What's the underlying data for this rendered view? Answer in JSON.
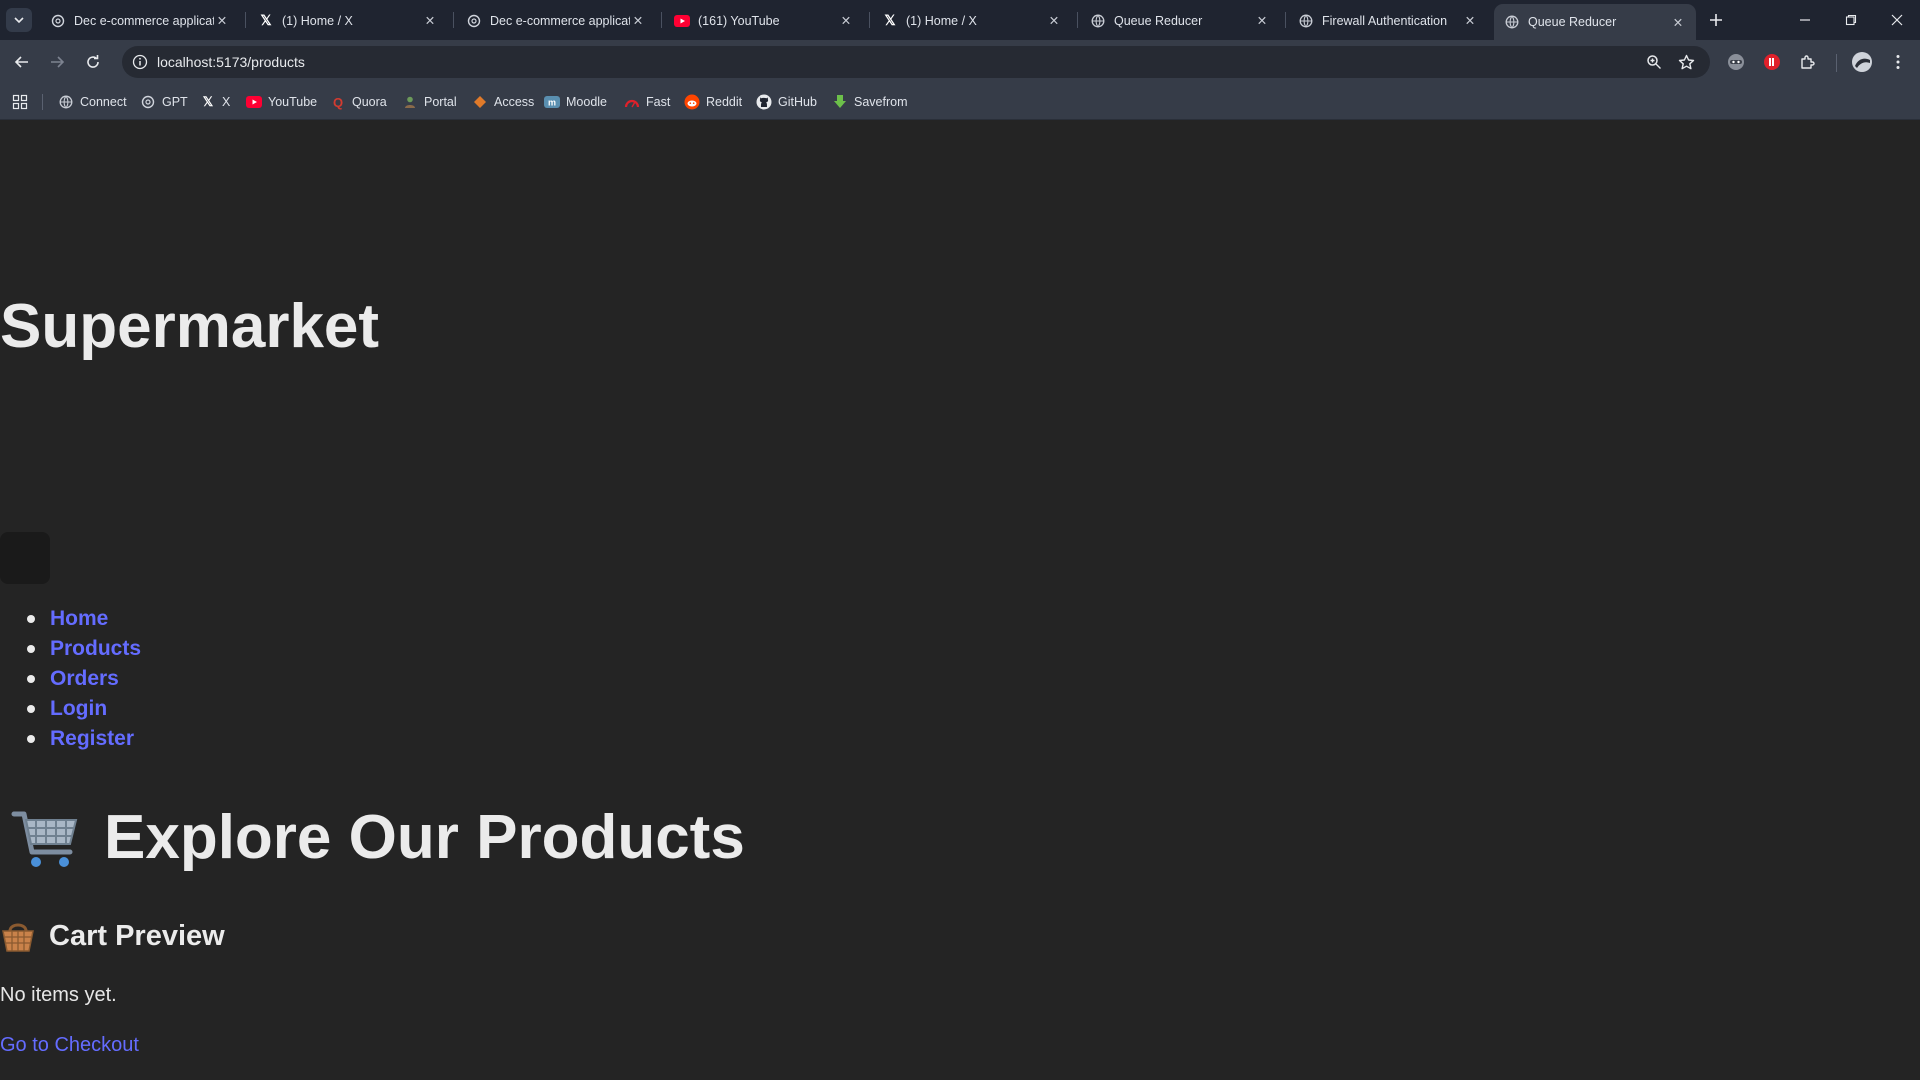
{
  "browser": {
    "tabs": [
      {
        "title": "Dec e-commerce applicat",
        "icon": "chatgpt-icon",
        "active": false
      },
      {
        "title": "(1) Home / X",
        "icon": "x-icon",
        "active": false
      },
      {
        "title": "Dec e-commerce applicat",
        "icon": "chatgpt-icon",
        "active": false
      },
      {
        "title": "(161) YouTube",
        "icon": "youtube-icon",
        "active": false
      },
      {
        "title": "(1) Home / X",
        "icon": "x-icon",
        "active": false
      },
      {
        "title": "Queue Reducer",
        "icon": "globe-icon",
        "active": false
      },
      {
        "title": "Firewall Authentication",
        "icon": "globe-icon",
        "active": false
      },
      {
        "title": "Queue Reducer",
        "icon": "globe-icon",
        "active": true
      }
    ],
    "url": "localhost:5173/products",
    "bookmarks": [
      {
        "label": "Connect",
        "icon": "globe-icon"
      },
      {
        "label": "GPT",
        "icon": "chatgpt-icon"
      },
      {
        "label": "X",
        "icon": "x-icon"
      },
      {
        "label": "YouTube",
        "icon": "youtube-icon"
      },
      {
        "label": "Quora",
        "icon": "quora-icon"
      },
      {
        "label": "Portal",
        "icon": "portal-icon"
      },
      {
        "label": "Access",
        "icon": "access-icon"
      },
      {
        "label": "Moodle",
        "icon": "moodle-icon"
      },
      {
        "label": "Fast",
        "icon": "speedometer-icon"
      },
      {
        "label": "Reddit",
        "icon": "reddit-icon"
      },
      {
        "label": "GitHub",
        "icon": "github-icon"
      },
      {
        "label": "Savefrom",
        "icon": "download-arrow-icon"
      }
    ],
    "colors": {
      "accent_youtube": "#ff0033",
      "tab_strip": "#1f2430",
      "toolbar": "#363c48"
    }
  },
  "page": {
    "site_title": "Supermarket",
    "nav": [
      "Home",
      "Products",
      "Orders",
      "Login",
      "Register"
    ],
    "products_heading": "Explore Our Products",
    "products_icon": "shopping-cart-emoji",
    "cart": {
      "heading": "Cart Preview",
      "icon": "basket-emoji",
      "empty_text": "No items yet.",
      "checkout_link": "Go to Checkout"
    },
    "colors": {
      "background": "#242424",
      "link": "#646cff",
      "text": "#ebebeb"
    }
  }
}
